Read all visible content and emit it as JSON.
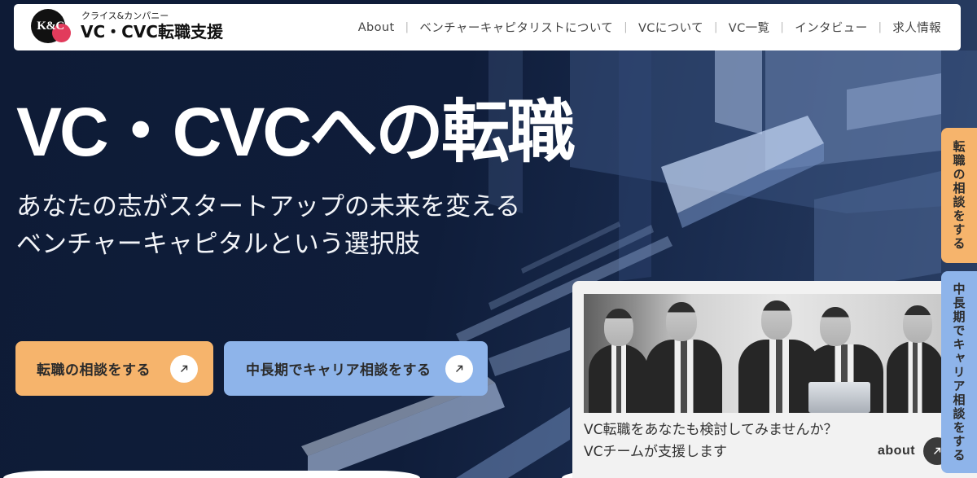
{
  "header": {
    "logo": {
      "mark": "K&C",
      "company": "クライス&カンパニー",
      "service": "VC・CVC転職支援"
    },
    "nav": [
      "About",
      "ベンチャーキャピタリストについて",
      "VCについて",
      "VC一覧",
      "インタビュー",
      "求人情報"
    ],
    "separator": "|"
  },
  "hero": {
    "title": "VC・CVCへの転職",
    "subtitle_lines": [
      "あなたの志がスタートアップの未来を変える",
      "ベンチャーキャピタルという選択肢"
    ],
    "cta_primary": "転職の相談をする",
    "cta_secondary": "中長期でキャリア相談をする"
  },
  "side_tabs": [
    "転職の相談をする",
    "中長期でキャリア相談をする"
  ],
  "about_card": {
    "text_lines": [
      "VC転職をあなたも検討してみませんか？",
      "VCチームが支援します"
    ],
    "link_label": "about"
  },
  "icons": {
    "cta_arrow": "arrow-up-right-icon",
    "card_arrow": "arrow-up-right-icon"
  },
  "colors": {
    "background_navy": "#0e1b36",
    "accent_orange": "#f6b46c",
    "accent_blue": "#8eb4ea",
    "text_dark": "#2b2b2b",
    "card_background": "#f2f2f2",
    "logo_red": "#e23b5c"
  }
}
